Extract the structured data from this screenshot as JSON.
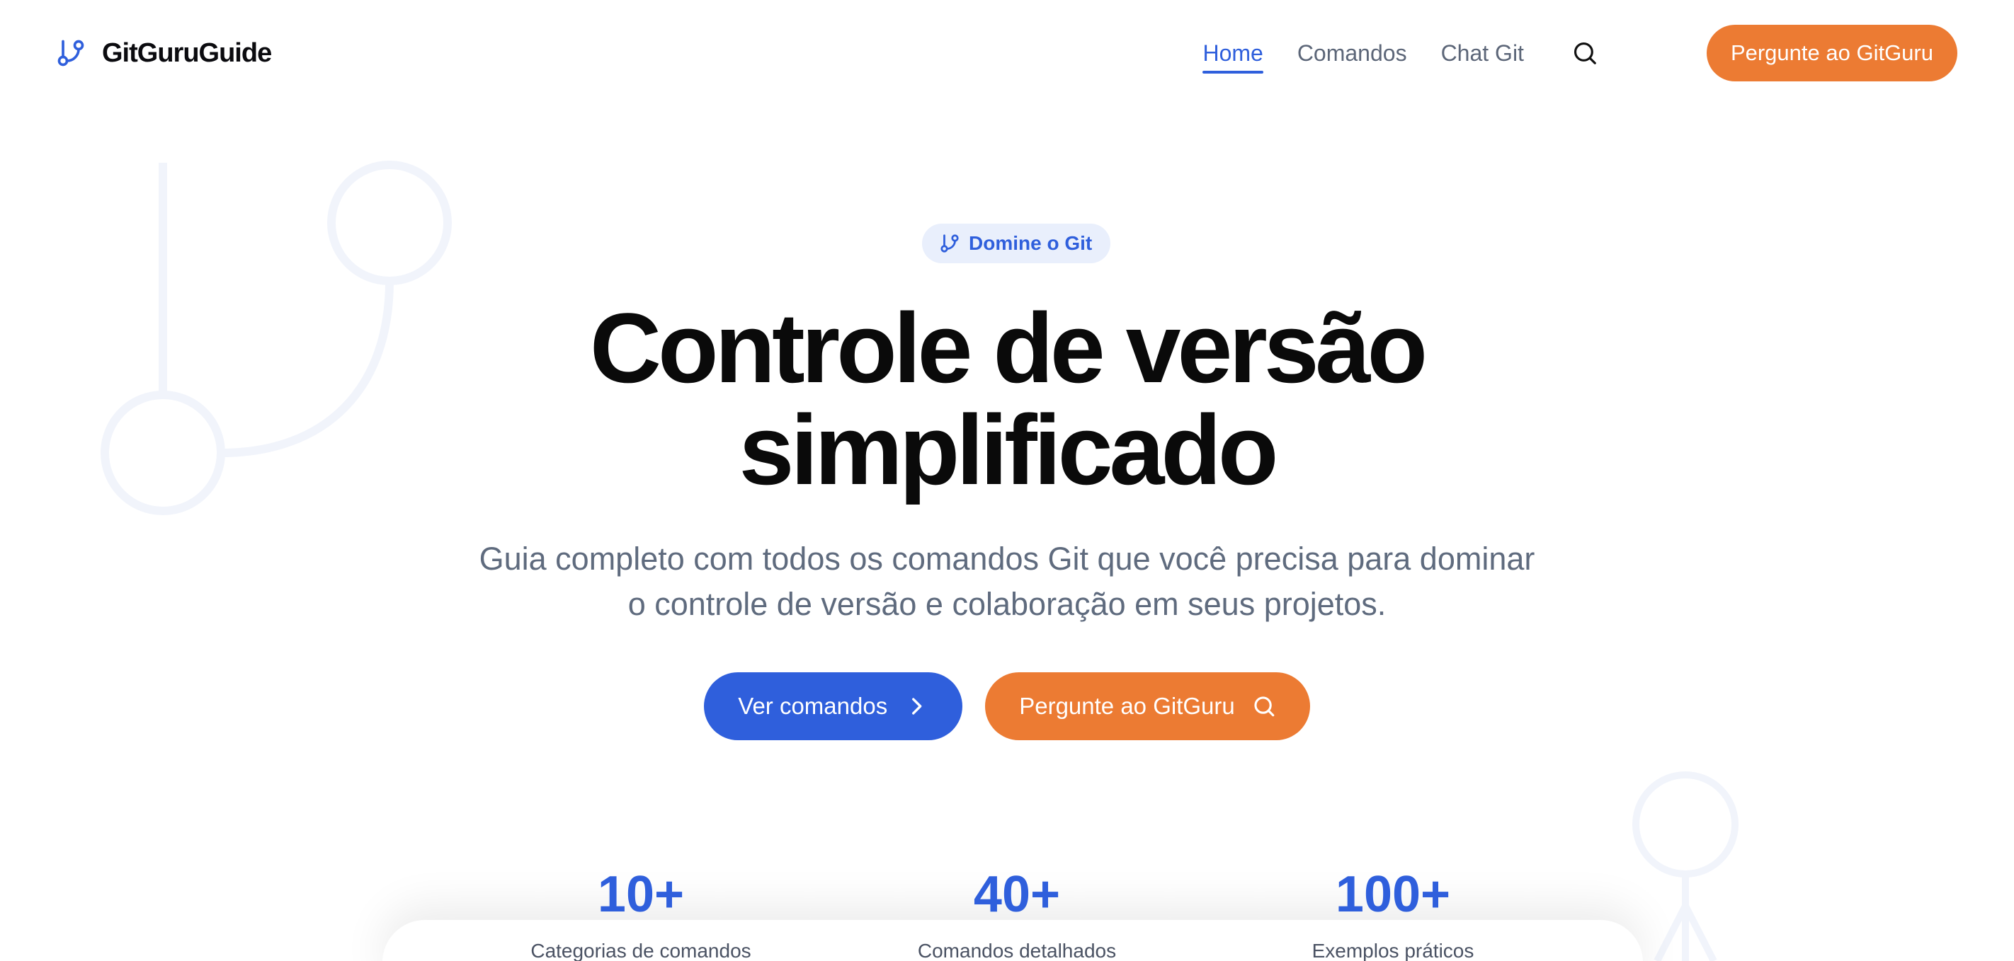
{
  "header": {
    "brand": "GitGuruGuide",
    "nav": [
      {
        "label": "Home",
        "active": true
      },
      {
        "label": "Comandos",
        "active": false
      },
      {
        "label": "Chat Git",
        "active": false
      }
    ],
    "search_icon": "search-icon",
    "cta_label": "Pergunte ao GitGuru"
  },
  "hero": {
    "badge": "Domine o Git",
    "title_line1": "Controle de versão",
    "title_line2": "simplificado",
    "subtitle_line1": "Guia completo com todos os comandos Git que você precisa para dominar",
    "subtitle_line2": "o controle de versão e colaboração em seus projetos.",
    "primary_button": "Ver comandos",
    "secondary_button": "Pergunte ao GitGuru"
  },
  "stats": [
    {
      "value": "10+",
      "label": "Categorias de comandos"
    },
    {
      "value": "40+",
      "label": "Comandos detalhados"
    },
    {
      "value": "100+",
      "label": "Exemplos práticos"
    }
  ],
  "colors": {
    "primary": "#2f5fdc",
    "accent": "#ec7b33",
    "text": "#0a0a0a",
    "muted": "#5f6b7e",
    "badge_bg": "#e9effc",
    "deco": "#f1f4fb"
  }
}
